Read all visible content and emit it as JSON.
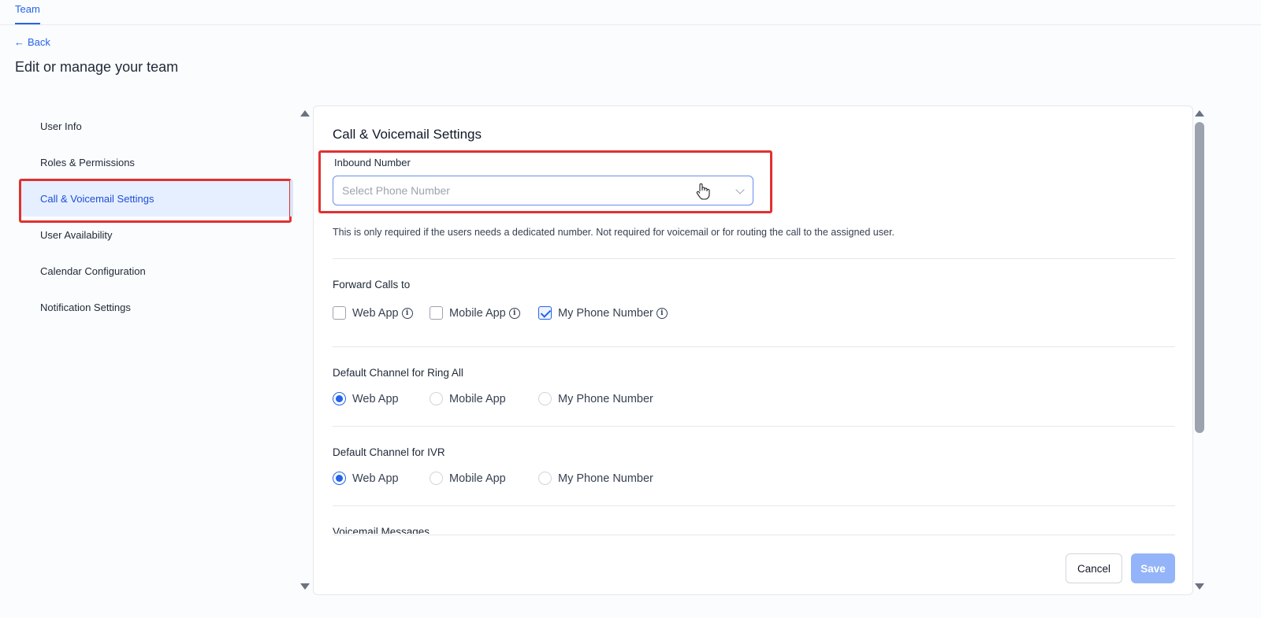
{
  "topbar": {
    "tab_label": "Team"
  },
  "nav": {
    "back_label": "Back",
    "back_arrow": "←"
  },
  "page": {
    "title": "Edit or manage your team"
  },
  "sidebar": {
    "items": [
      {
        "label": "User Info"
      },
      {
        "label": "Roles & Permissions"
      },
      {
        "label": "Call & Voicemail Settings",
        "active": true
      },
      {
        "label": "User Availability"
      },
      {
        "label": "Calendar Configuration"
      },
      {
        "label": "Notification Settings"
      }
    ]
  },
  "panel": {
    "title": "Call & Voicemail Settings",
    "inbound": {
      "label": "Inbound Number",
      "placeholder": "Select Phone Number",
      "help": "This is only required if the users needs a dedicated number. Not required for voicemail or for routing the call to the assigned user."
    },
    "forward": {
      "label": "Forward Calls to",
      "options": [
        {
          "label": "Web App",
          "checked": false
        },
        {
          "label": "Mobile App",
          "checked": false
        },
        {
          "label": "My Phone Number",
          "checked": true
        }
      ]
    },
    "ring_all": {
      "label": "Default Channel for Ring All",
      "options": [
        {
          "label": "Web App",
          "selected": true
        },
        {
          "label": "Mobile App",
          "selected": false
        },
        {
          "label": "My Phone Number",
          "selected": false
        }
      ]
    },
    "ivr": {
      "label": "Default Channel for IVR",
      "options": [
        {
          "label": "Web App",
          "selected": true
        },
        {
          "label": "Mobile App",
          "selected": false
        },
        {
          "label": "My Phone Number",
          "selected": false
        }
      ]
    },
    "voicemail": {
      "label": "Voicemail Messages"
    },
    "actions": {
      "cancel_label": "Cancel",
      "save_label": "Save"
    }
  },
  "colors": {
    "accent": "#2563eb",
    "highlight": "#e03131",
    "save_disabled": "#93b4f8"
  }
}
